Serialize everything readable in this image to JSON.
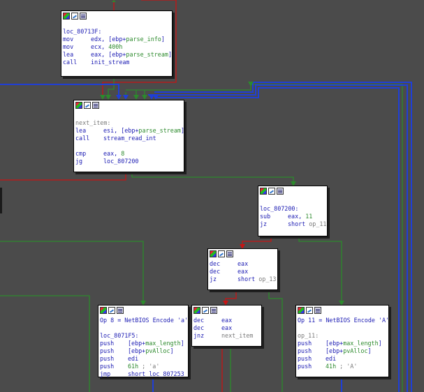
{
  "nodes": {
    "n1": {
      "lines": [
        {
          "label": "loc_80713F:"
        },
        {
          "mnem": "mov",
          "ops": [
            {
              "t": "edx, [ebp+",
              "c": "op"
            },
            {
              "t": "parse_info",
              "c": "var"
            },
            {
              "t": "]",
              "c": "op"
            }
          ]
        },
        {
          "mnem": "mov",
          "ops": [
            {
              "t": "ecx, ",
              "c": "op"
            },
            {
              "t": "400h",
              "c": "num"
            }
          ]
        },
        {
          "mnem": "lea",
          "ops": [
            {
              "t": "eax, [ebp+",
              "c": "op"
            },
            {
              "t": "parse_stream",
              "c": "var"
            },
            {
              "t": "]",
              "c": "op"
            }
          ]
        },
        {
          "mnem": "call",
          "ops": [
            {
              "t": "init_stream",
              "c": "op"
            }
          ]
        }
      ]
    },
    "n2": {
      "lines": [
        {
          "blank": true
        },
        {
          "label_gray": "next_item:"
        },
        {
          "mnem": "lea",
          "ops": [
            {
              "t": "esi, [ebp+",
              "c": "op"
            },
            {
              "t": "parse_stream",
              "c": "var"
            },
            {
              "t": "]",
              "c": "op"
            }
          ]
        },
        {
          "mnem": "call",
          "ops": [
            {
              "t": "stream_read_int",
              "c": "op"
            }
          ]
        },
        {
          "blank": true
        },
        {
          "mnem": "cmp",
          "ops": [
            {
              "t": "eax, ",
              "c": "op"
            },
            {
              "t": "8",
              "c": "num"
            }
          ]
        },
        {
          "mnem": "jg",
          "ops": [
            {
              "t": "loc_807200",
              "c": "op"
            }
          ]
        }
      ]
    },
    "n3": {
      "lines": [
        {
          "blank": true
        },
        {
          "label": "loc_807200:"
        },
        {
          "mnem": "sub",
          "ops": [
            {
              "t": "eax, ",
              "c": "op"
            },
            {
              "t": "11",
              "c": "num"
            }
          ]
        },
        {
          "mnem": "jz",
          "ops": [
            {
              "t": "short ",
              "c": "op"
            },
            {
              "t": "op_11",
              "c": "ref"
            }
          ]
        }
      ]
    },
    "n4": {
      "lines": [
        {
          "mnem": "dec",
          "ops": [
            {
              "t": "eax",
              "c": "op"
            }
          ]
        },
        {
          "mnem": "dec",
          "ops": [
            {
              "t": "eax",
              "c": "op"
            }
          ]
        },
        {
          "mnem": "jz",
          "ops": [
            {
              "t": "short ",
              "c": "op"
            },
            {
              "t": "op_13",
              "c": "ref"
            }
          ]
        }
      ]
    },
    "n5": {
      "lines": [
        {
          "comment": "Op 8 = NetBIOS Encode 'a'"
        },
        {
          "blank": true
        },
        {
          "label": "loc_8071F5:"
        },
        {
          "mnem": "push",
          "ops": [
            {
              "t": "[ebp+",
              "c": "op"
            },
            {
              "t": "max_length",
              "c": "var"
            },
            {
              "t": "]",
              "c": "op"
            }
          ]
        },
        {
          "mnem": "push",
          "ops": [
            {
              "t": "[ebp+",
              "c": "op"
            },
            {
              "t": "pvAlloc",
              "c": "var"
            },
            {
              "t": "]",
              "c": "op"
            }
          ]
        },
        {
          "mnem": "push",
          "ops": [
            {
              "t": "edi",
              "c": "op"
            }
          ]
        },
        {
          "mnem": "push",
          "ops": [
            {
              "t": "61h",
              "c": "num"
            },
            {
              "t": " ; 'a'",
              "c": "ref"
            }
          ]
        },
        {
          "mnem": "jmp",
          "ops": [
            {
              "t": "short loc_807253",
              "c": "op"
            }
          ]
        }
      ]
    },
    "n6": {
      "lines": [
        {
          "mnem": "dec",
          "ops": [
            {
              "t": "eax",
              "c": "op"
            }
          ]
        },
        {
          "mnem": "dec",
          "ops": [
            {
              "t": "eax",
              "c": "op"
            }
          ]
        },
        {
          "mnem": "jnz",
          "ops": [
            {
              "t": "next_item",
              "c": "ref"
            }
          ]
        }
      ]
    },
    "n7": {
      "lines": [
        {
          "comment": "Op 11 = NetBIOS Encode 'A'"
        },
        {
          "blank": true
        },
        {
          "label_gray": "op_11:"
        },
        {
          "mnem": "push",
          "ops": [
            {
              "t": "[ebp+",
              "c": "op"
            },
            {
              "t": "max_length",
              "c": "var"
            },
            {
              "t": "]",
              "c": "op"
            }
          ]
        },
        {
          "mnem": "push",
          "ops": [
            {
              "t": "[ebp+",
              "c": "op"
            },
            {
              "t": "pvAlloc",
              "c": "var"
            },
            {
              "t": "]",
              "c": "op"
            }
          ]
        },
        {
          "mnem": "push",
          "ops": [
            {
              "t": "edi",
              "c": "op"
            }
          ]
        },
        {
          "mnem": "push",
          "ops": [
            {
              "t": "41h",
              "c": "num"
            },
            {
              "t": " ; 'A'",
              "c": "ref"
            }
          ]
        }
      ]
    }
  },
  "colors": {
    "background": "#4b4b4b",
    "edge_true": "#2c8a2c",
    "edge_false": "#c81414",
    "edge_uncond": "#1f3fd8"
  }
}
